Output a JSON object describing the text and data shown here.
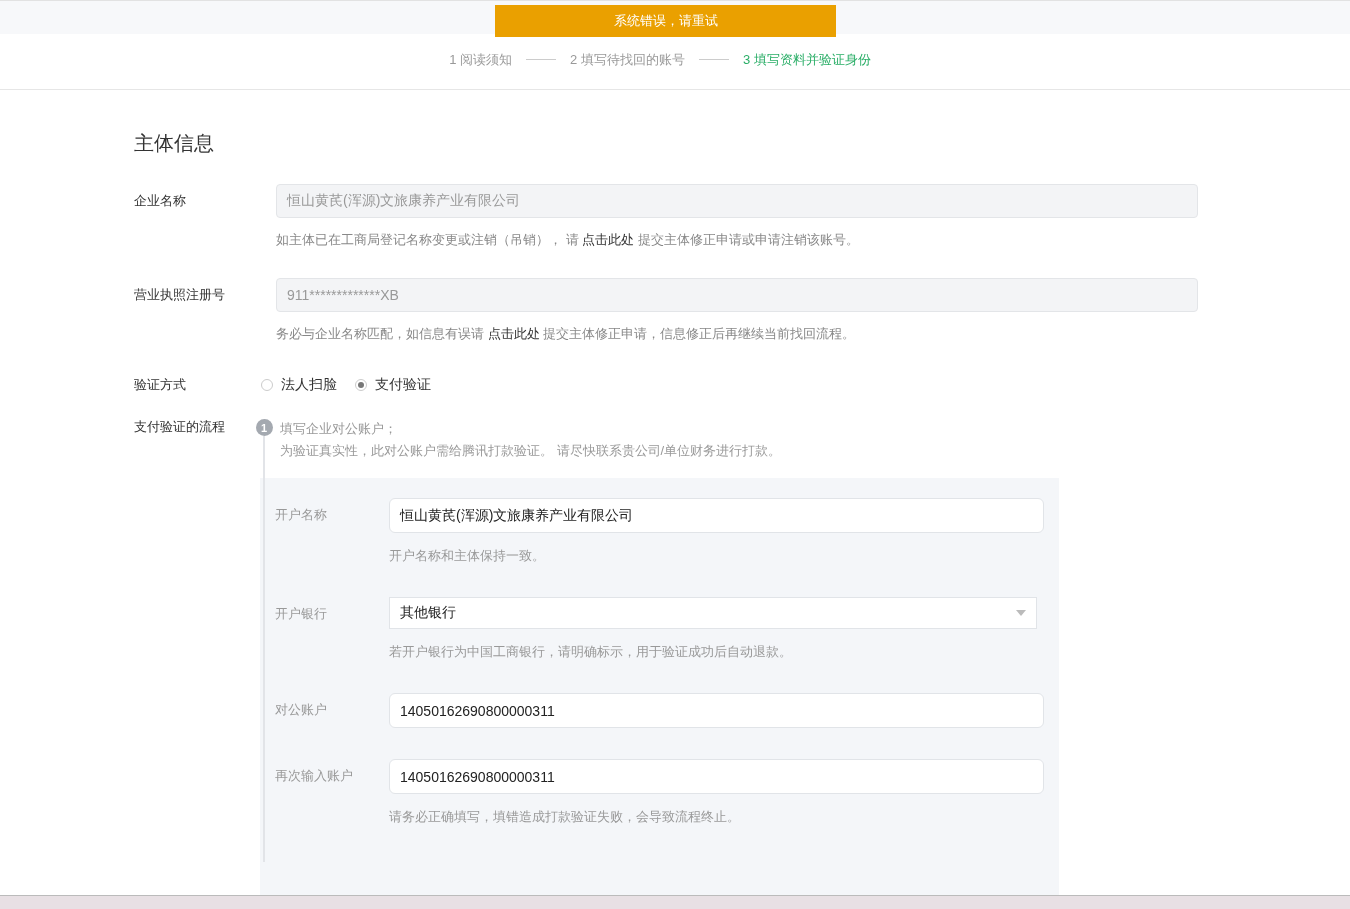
{
  "error_banner": "系统错误，请重试",
  "steps": [
    {
      "label": "1 阅读须知",
      "selected": false
    },
    {
      "label": "2 填写待找回的账号",
      "selected": false
    },
    {
      "label": "3 填写资料并验证身份",
      "selected": true
    }
  ],
  "section_title": "主体信息",
  "fields": [
    {
      "label": "企业名称",
      "value": "恒山黄芪(浑源)文旅康养产业有限公司",
      "disabled": true,
      "hint_before": "如主体已在工商局登记名称变更或注销（吊销）， 请",
      "hint_link": "点击此处",
      "hint_after": "提交主体修正申请或申请注销该账号。"
    },
    {
      "label": "营业执照注册号",
      "value": "911*************XB",
      "disabled": true,
      "hint_before": "务必与企业名称匹配，如信息有误请",
      "hint_link": "点击此处",
      "hint_after": "提交主体修正申请，信息修正后再继续当前找回流程。"
    }
  ],
  "verification": {
    "label": "验证方式",
    "options": [
      {
        "label": "法人扫脸",
        "selected": false
      },
      {
        "label": "支付验证",
        "selected": true
      }
    ]
  },
  "flow": {
    "label": "支付验证的流程",
    "steps": [
      {
        "number": "1",
        "title": "填写企业对公账户；",
        "description": "为验证真实性，此对公账户需给腾讯打款验证。 请尽快联系贵公司/单位财务进行打款。"
      }
    ]
  },
  "account_form": [
    {
      "kind": "input",
      "label": "开户名称",
      "value": "恒山黄芪(浑源)文旅康养产业有限公司",
      "hint": "开户名称和主体保持一致。"
    },
    {
      "kind": "select",
      "label": "开户银行",
      "value": "其他银行",
      "hint": "若开户银行为中国工商银行，请明确标示，用于验证成功后自动退款。"
    },
    {
      "kind": "input",
      "label": "对公账户",
      "value": "14050162690800000311"
    },
    {
      "kind": "input",
      "label": "再次输入账户",
      "value": "14050162690800000311",
      "hint": "请务必正确填写，填错造成打款验证失败，会导致流程终止。"
    }
  ]
}
